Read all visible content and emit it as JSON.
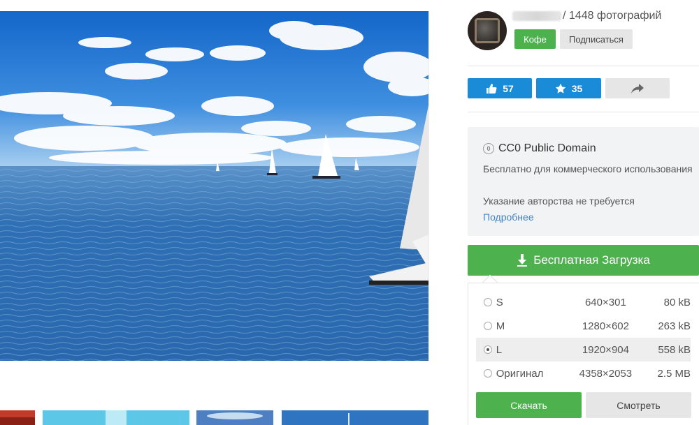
{
  "author": {
    "photo_count": "/ 1448 фотографий",
    "coffee_label": "Кофе",
    "subscribe_label": "Подписаться"
  },
  "actions": {
    "likes": "57",
    "favorites": "35",
    "like_icon": "thumbs-up-icon",
    "favorite_icon": "star-icon",
    "share_icon": "share-arrow-icon"
  },
  "license": {
    "title": "CC0 Public Domain",
    "icon_text": "0",
    "line1": "Бесплатно для коммерческого использования",
    "line2": "Указание авторства не требуется",
    "more_link": "Подробнее"
  },
  "download": {
    "button_label": "Бесплатная Загрузка",
    "sizes": [
      {
        "label": "S",
        "dimensions": "640×301",
        "size": "80 kB",
        "selected": false
      },
      {
        "label": "M",
        "dimensions": "1280×602",
        "size": "263 kB",
        "selected": false
      },
      {
        "label": "L",
        "dimensions": "1920×904",
        "size": "558 kB",
        "selected": true
      },
      {
        "label": "Оригинал",
        "dimensions": "4358×2053",
        "size": "2.5 MB",
        "selected": false
      }
    ],
    "get_label": "Скачать",
    "view_label": "Смотреть"
  },
  "colors": {
    "green": "#4db24d",
    "blue": "#1a8bd6",
    "link": "#3d83c6"
  }
}
